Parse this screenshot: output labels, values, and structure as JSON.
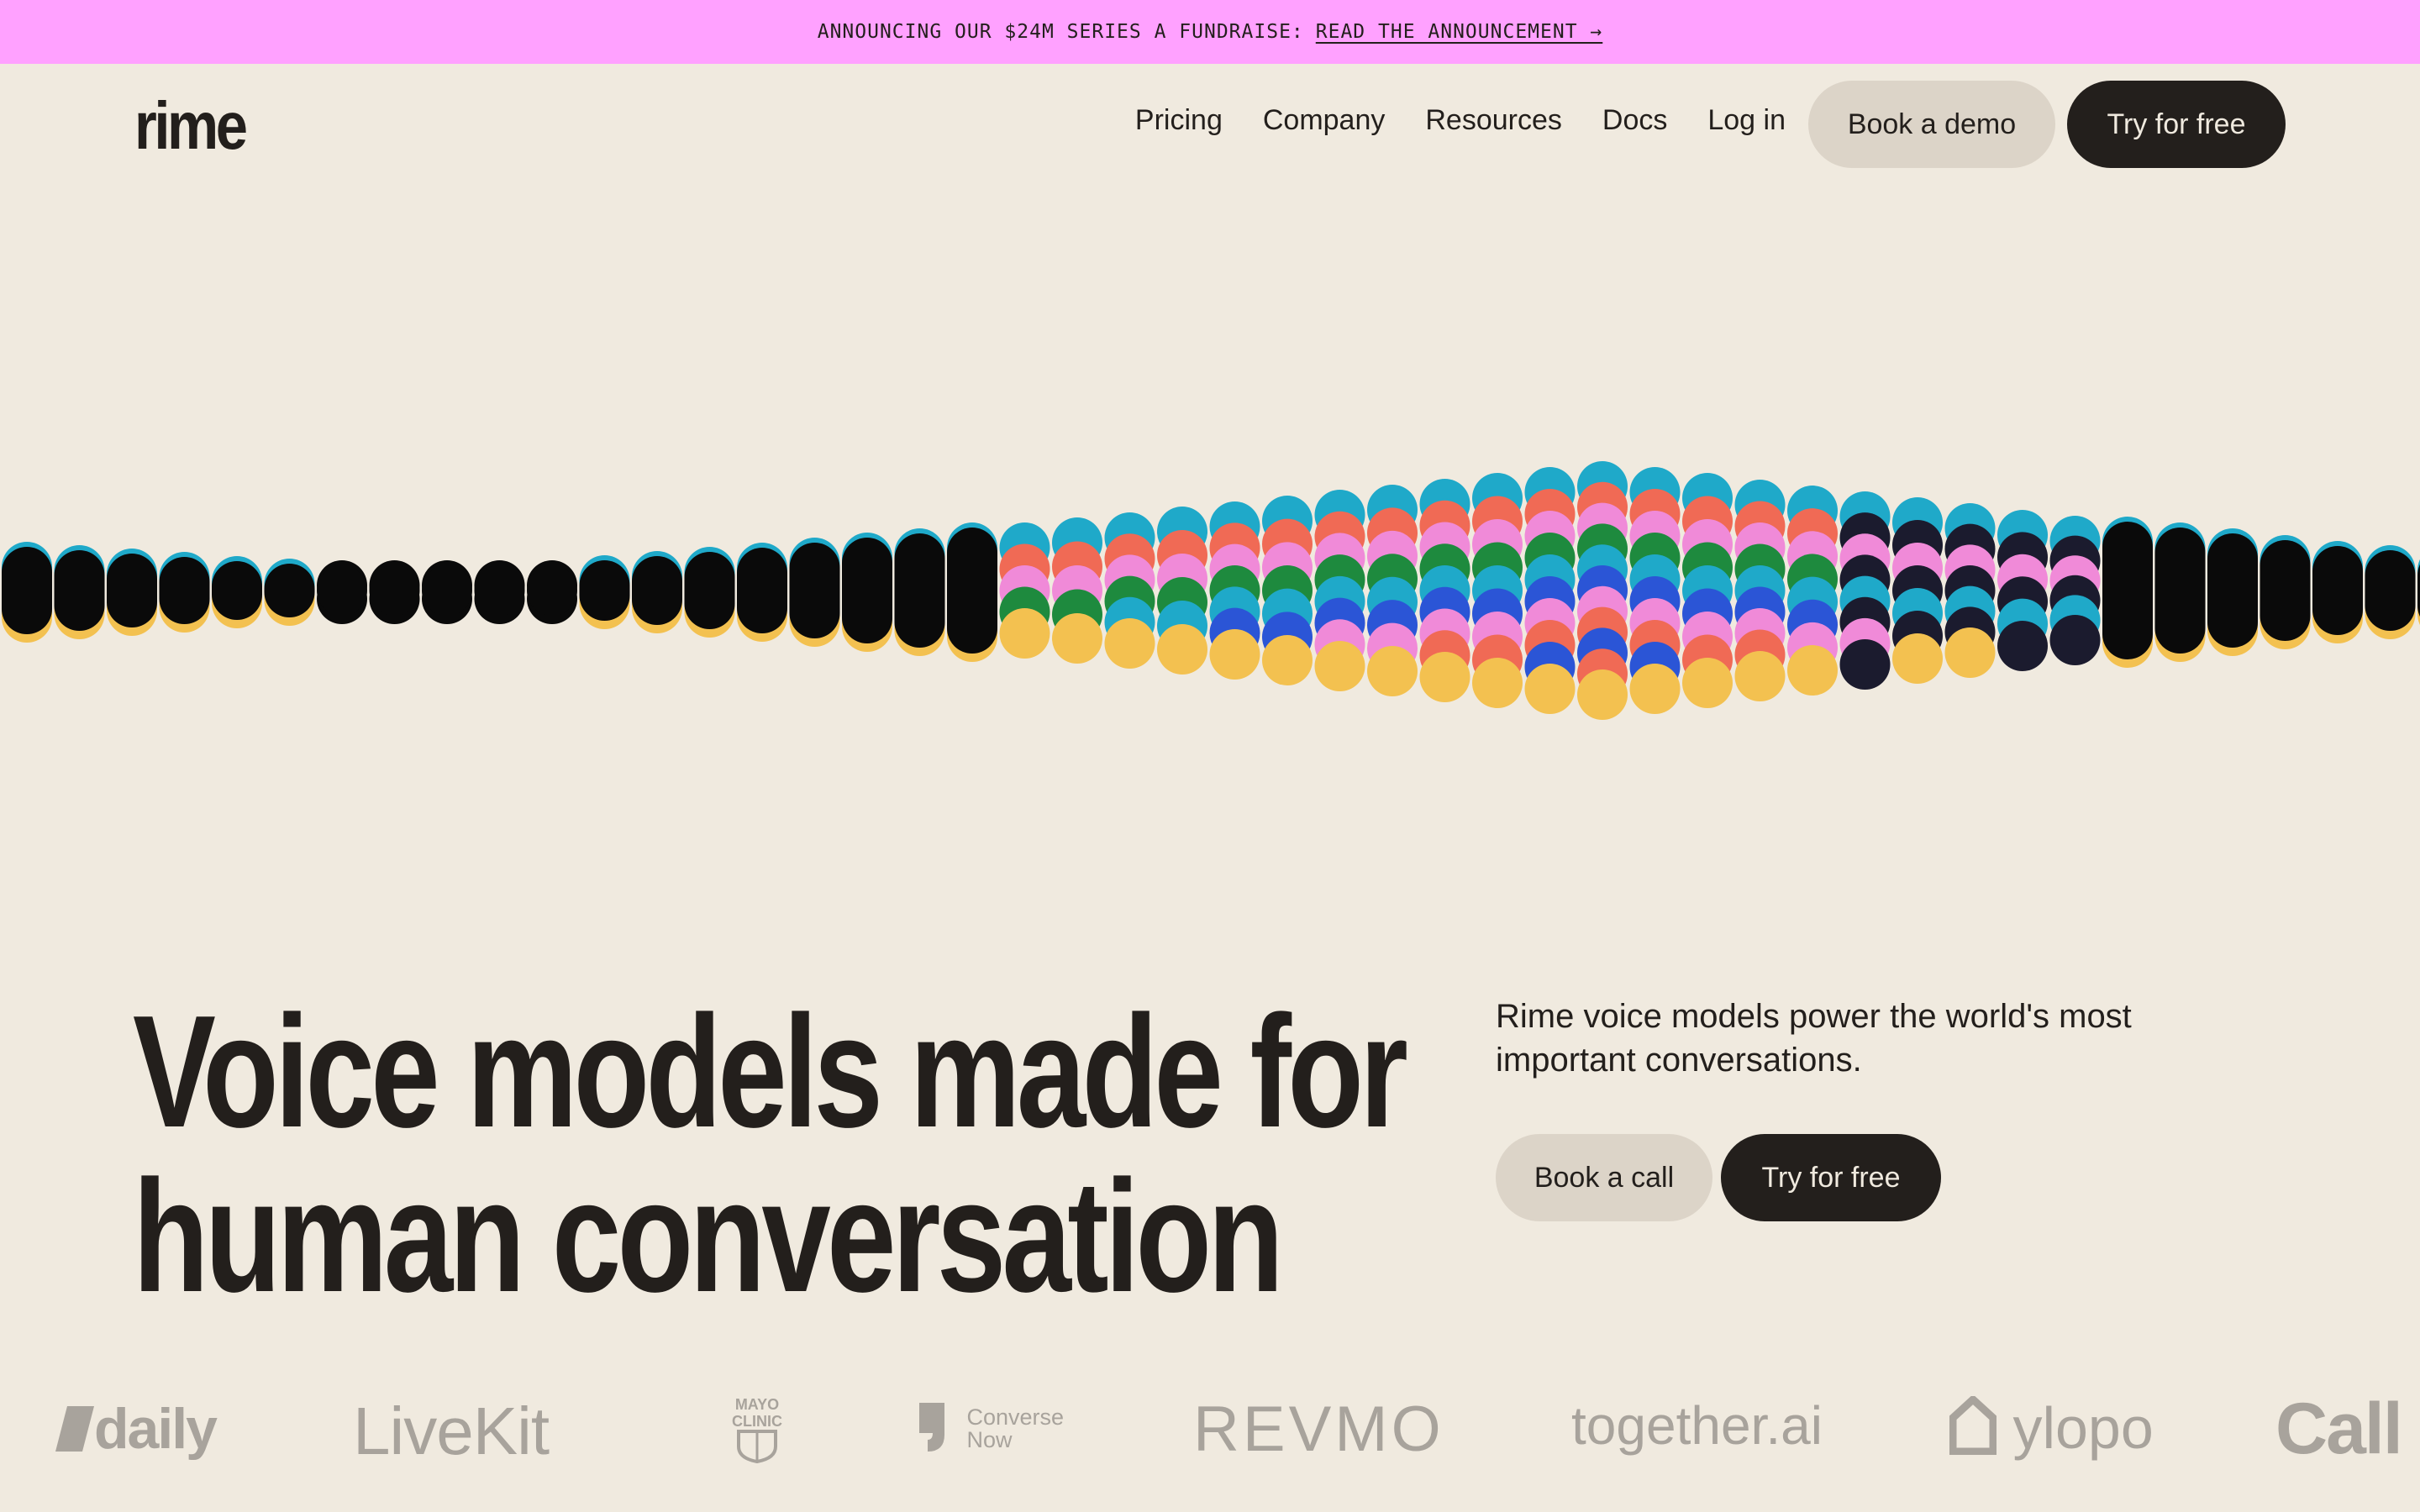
{
  "banner": {
    "text": "ANNOUNCING OUR $24M SERIES A FUNDRAISE:",
    "link": "READ THE ANNOUNCEMENT →"
  },
  "nav": {
    "logo": "rime",
    "links": [
      "Pricing",
      "Company",
      "Resources",
      "Docs",
      "Log in"
    ],
    "demo_button": "Book a demo",
    "try_button": "Try for free"
  },
  "hero": {
    "headline_line1": "Voice models made for",
    "headline_line2": "human conversation",
    "subtitle": "Rime voice models power the world's most important conversations.",
    "book_call": "Book a call",
    "try_free": "Try for free"
  },
  "customers": [
    "daily",
    "LiveKit",
    "MAYO CLINIC",
    "Converse Now",
    "REVMO",
    "together.ai",
    "ylopo",
    "Call"
  ],
  "colors": {
    "background": "#f0eadf",
    "banner": "#ffa1ff",
    "dark": "#231f1c",
    "wave": [
      "#1fa9c9",
      "#2b55d6",
      "#1e8a3e",
      "#f06a55",
      "#f08ad8",
      "#f3c150",
      "#0a0a0a"
    ]
  },
  "icons": [
    "arrow-right-icon",
    "daily-logo-icon",
    "mayo-shield-icon",
    "conversenow-icon",
    "ylopo-house-icon"
  ]
}
